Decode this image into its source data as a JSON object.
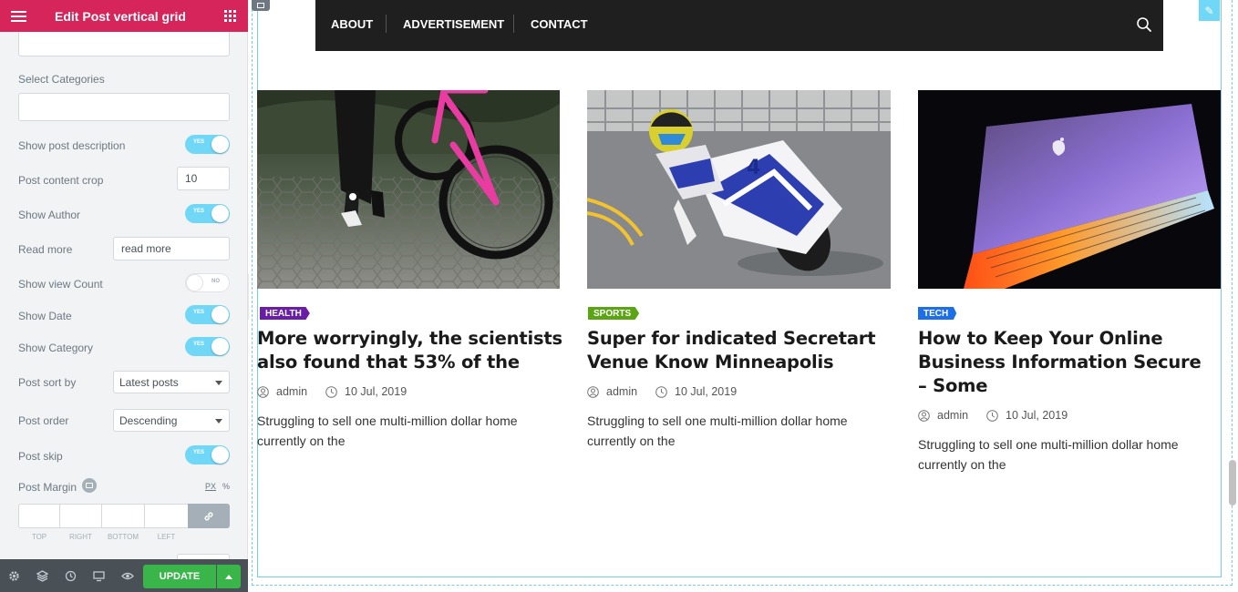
{
  "panel": {
    "title": "Edit Post vertical grid",
    "select_categories_label": "Select Categories",
    "show_post_description_label": "Show post description",
    "post_content_crop_label": "Post content crop",
    "post_content_crop_value": "10",
    "show_author_label": "Show Author",
    "read_more_label": "Read more",
    "read_more_value": "read more",
    "show_view_count_label": "Show view Count",
    "show_date_label": "Show Date",
    "show_category_label": "Show Category",
    "post_sort_by_label": "Post sort by",
    "post_sort_by_value": "Latest posts",
    "post_order_label": "Post order",
    "post_order_value": "Descending",
    "post_skip_label": "Post skip",
    "post_margin_label": "Post Margin",
    "unit_px": "PX",
    "unit_percent": "%",
    "toggle_yes": "YES",
    "toggle_no": "NO",
    "toggles": {
      "show_post_description": true,
      "show_author": true,
      "show_view_count": false,
      "show_date": true,
      "show_category": true,
      "post_skip": true
    },
    "margin_labels": {
      "top": "TOP",
      "right": "RIGHT",
      "bottom": "BOTTOM",
      "left": "LEFT"
    }
  },
  "footer": {
    "update_label": "UPDATE",
    "icons": [
      "settings-icon",
      "layers-icon",
      "history-icon",
      "responsive-icon",
      "preview-eye-icon"
    ]
  },
  "nav": {
    "items": [
      "ABOUT",
      "ADVERTISEMENT",
      "CONTACT"
    ]
  },
  "posts": [
    {
      "category": "HEALTH",
      "category_color": "#6a1ea8",
      "title": "More worryingly, the scientists also found that 53% of the",
      "author": "admin",
      "date": "10 Jul, 2019",
      "excerpt": "Struggling to sell one multi-million dollar home currently on the"
    },
    {
      "category": "SPORTS",
      "category_color": "#5ba413",
      "title": "Super for indicated Secretart Venue Know Minneapolis",
      "author": "admin",
      "date": "10 Jul, 2019",
      "excerpt": "Struggling to sell one multi-million dollar home currently on the"
    },
    {
      "category": "TECH",
      "category_color": "#1d6fe8",
      "title": "How to Keep Your Online Business Information Secure – Some",
      "author": "admin",
      "date": "10 Jul, 2019",
      "excerpt": "Struggling to sell one multi-million dollar home currently on the"
    }
  ],
  "colors": {
    "panel_header": "#d5255a",
    "toggle_on": "#71d7f7",
    "update_button": "#39b54a",
    "nav_background": "#1f1f1f",
    "frame_outline": "#74cdea"
  }
}
